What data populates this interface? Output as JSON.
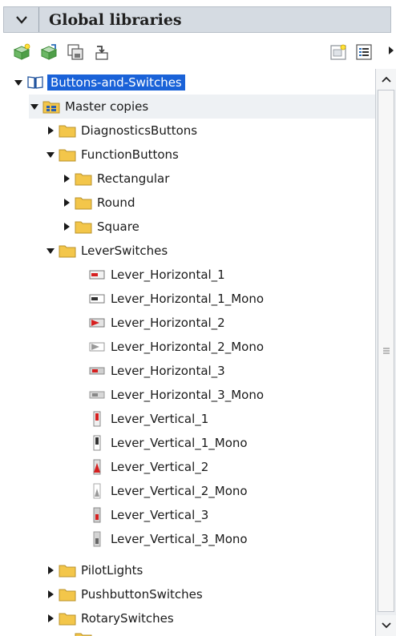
{
  "header": {
    "title": "Global libraries"
  },
  "toolbar": {
    "buttons": [
      {
        "icon": "create-library-icon"
      },
      {
        "icon": "open-library-icon"
      },
      {
        "icon": "save-library-icon"
      },
      {
        "icon": "close-library-icon"
      },
      {
        "icon": "new-folder-icon"
      },
      {
        "icon": "view-options-icon"
      }
    ]
  },
  "tree": {
    "root": {
      "label": "Buttons-and-Switches",
      "expanded": true,
      "selected": true
    },
    "master_copies": {
      "label": "Master copies",
      "expanded": true
    },
    "items": [
      {
        "label": "DiagnosticsButtons",
        "type": "folder",
        "expanded": false
      },
      {
        "label": "FunctionButtons",
        "type": "folder",
        "expanded": true
      },
      {
        "label": "Rectangular",
        "type": "folder",
        "expanded": false
      },
      {
        "label": "Round",
        "type": "folder",
        "expanded": false
      },
      {
        "label": "Square",
        "type": "folder",
        "expanded": false
      },
      {
        "label": "LeverSwitches",
        "type": "folder",
        "expanded": true
      },
      {
        "label": "Lever_Horizontal_1",
        "type": "element"
      },
      {
        "label": "Lever_Horizontal_1_Mono",
        "type": "element"
      },
      {
        "label": "Lever_Horizontal_2",
        "type": "element"
      },
      {
        "label": "Lever_Horizontal_2_Mono",
        "type": "element"
      },
      {
        "label": "Lever_Horizontal_3",
        "type": "element"
      },
      {
        "label": "Lever_Horizontal_3_Mono",
        "type": "element"
      },
      {
        "label": "Lever_Vertical_1",
        "type": "element"
      },
      {
        "label": "Lever_Vertical_1_Mono",
        "type": "element"
      },
      {
        "label": "Lever_Vertical_2",
        "type": "element"
      },
      {
        "label": "Lever_Vertical_2_Mono",
        "type": "element"
      },
      {
        "label": "Lever_Vertical_3",
        "type": "element"
      },
      {
        "label": "Lever_Vertical_3_Mono",
        "type": "element"
      },
      {
        "label": "PilotLights",
        "type": "folder",
        "expanded": false
      },
      {
        "label": "PushbuttonSwitches",
        "type": "folder",
        "expanded": false
      },
      {
        "label": "RotarySwitches",
        "type": "folder",
        "expanded": false
      }
    ]
  },
  "colors": {
    "selection": "#1a62d8",
    "folder": "#f3c64a",
    "header": "#d5dbe2"
  }
}
